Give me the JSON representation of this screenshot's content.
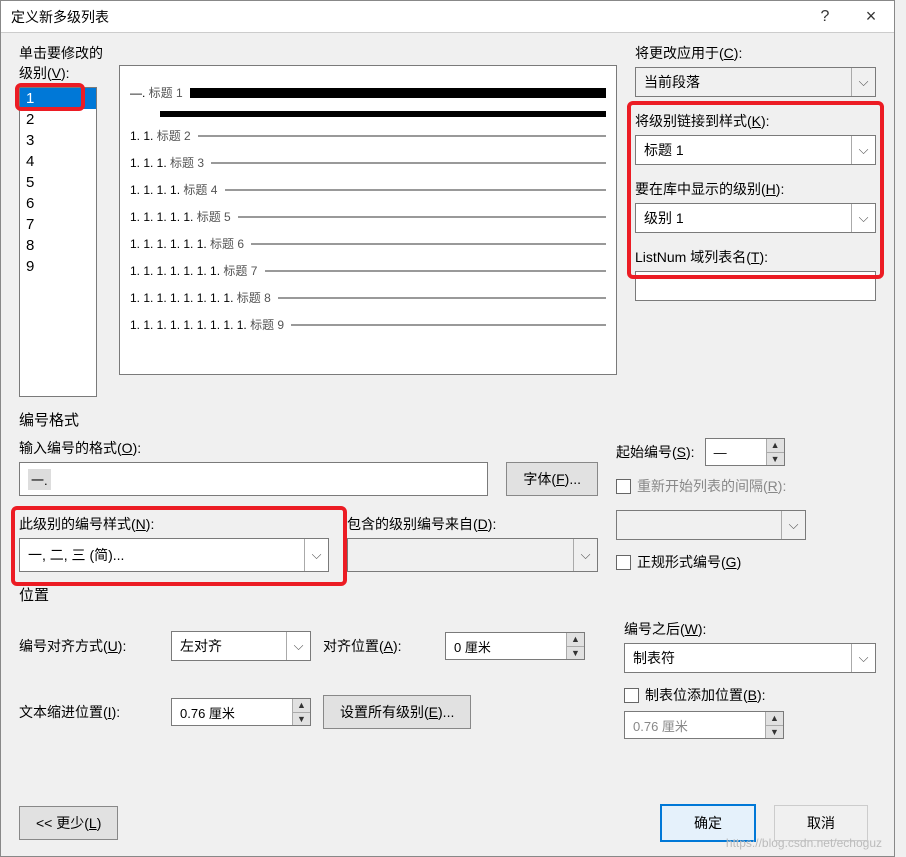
{
  "title": "定义新多级列表",
  "titlebar": {
    "help": "?",
    "close": "×"
  },
  "labels": {
    "clickLevel": "单击要修改的级别(",
    "clickLevelKey": "V",
    "clickLevelEnd": "):",
    "applyTo": "将更改应用于(",
    "applyToKey": "C",
    "applyToEnd": "):",
    "linkStyle": "将级别链接到样式(",
    "linkStyleKey": "K",
    "linkStyleEnd": "):",
    "showLevel": "要在库中显示的级别(",
    "showLevelKey": "H",
    "showLevelEnd": "):",
    "listnum": "ListNum 域列表名(",
    "listnumKey": "T",
    "listnumEnd": "):",
    "numberFormat": "编号格式",
    "enterFormat": "输入编号的格式(",
    "enterFormatKey": "O",
    "enterFormatEnd": "):",
    "fontBtn": "字体(",
    "fontBtnKey": "F",
    "fontBtnEnd": ")...",
    "numStyle": "此级别的编号样式(",
    "numStyleKey": "N",
    "numStyleEnd": "):",
    "includeFrom": "包含的级别编号来自(",
    "includeFromKey": "D",
    "includeFromEnd": "):",
    "startAt": "起始编号(",
    "startAtKey": "S",
    "startAtEnd": "):",
    "restart": "重新开始列表的间隔(",
    "restartKey": "R",
    "restartEnd": "):",
    "legal": "正规形式编号(",
    "legalKey": "G",
    "legalEnd": ")",
    "position": "位置",
    "align": "编号对齐方式(",
    "alignKey": "U",
    "alignEnd": "):",
    "alignAt": "对齐位置(",
    "alignAtKey": "A",
    "alignAtEnd": "):",
    "textIndent": "文本缩进位置(",
    "textIndentKey": "I",
    "textIndentEnd": "):",
    "setAll": "设置所有级别(",
    "setAllKey": "E",
    "setAllEnd": ")...",
    "followBy": "编号之后(",
    "followByKey": "W",
    "followByEnd": "):",
    "tabStop": "制表位添加位置(",
    "tabStopKey": "B",
    "tabStopEnd": "):",
    "less": "<< 更少(",
    "lessKey": "L",
    "lessEnd": ")",
    "ok": "确定",
    "cancel": "取消"
  },
  "levels": [
    "1",
    "2",
    "3",
    "4",
    "5",
    "6",
    "7",
    "8",
    "9"
  ],
  "preview": [
    {
      "num": "—.",
      "heading": " 标题 1 ",
      "indent": 0,
      "first": true
    },
    {
      "num": "1. 1.",
      "heading": " 标题 2 ",
      "indent": 0
    },
    {
      "num": "1. 1. 1.",
      "heading": " 标题 3 ",
      "indent": 0
    },
    {
      "num": "1. 1. 1. 1.",
      "heading": " 标题 4 ",
      "indent": 0
    },
    {
      "num": "1. 1. 1. 1. 1.",
      "heading": " 标题 5 ",
      "indent": 0
    },
    {
      "num": "1. 1. 1. 1. 1. 1.",
      "heading": " 标题 6 ",
      "indent": 0
    },
    {
      "num": "1. 1. 1. 1. 1. 1. 1.",
      "heading": " 标题 7 ",
      "indent": 0
    },
    {
      "num": "1. 1. 1. 1. 1. 1. 1. 1.",
      "heading": " 标题 8 ",
      "indent": 0
    },
    {
      "num": "1. 1. 1. 1. 1. 1. 1. 1. 1.",
      "heading": " 标题 9 ",
      "indent": 0
    }
  ],
  "values": {
    "applyTo": "当前段落",
    "linkStyle": "标题 1",
    "showLevel": "级别 1",
    "listnum": "",
    "formatText": "一.",
    "numStyle": "一, 二, 三 (简)...",
    "includeFrom": "",
    "startAt": "—",
    "restart": "",
    "align": "左对齐",
    "alignAt": "0 厘米",
    "textIndent": "0.76 厘米",
    "followBy": "制表符",
    "tabStop": "0.76 厘米"
  },
  "watermark": "https://blog.csdn.net/echoguz"
}
